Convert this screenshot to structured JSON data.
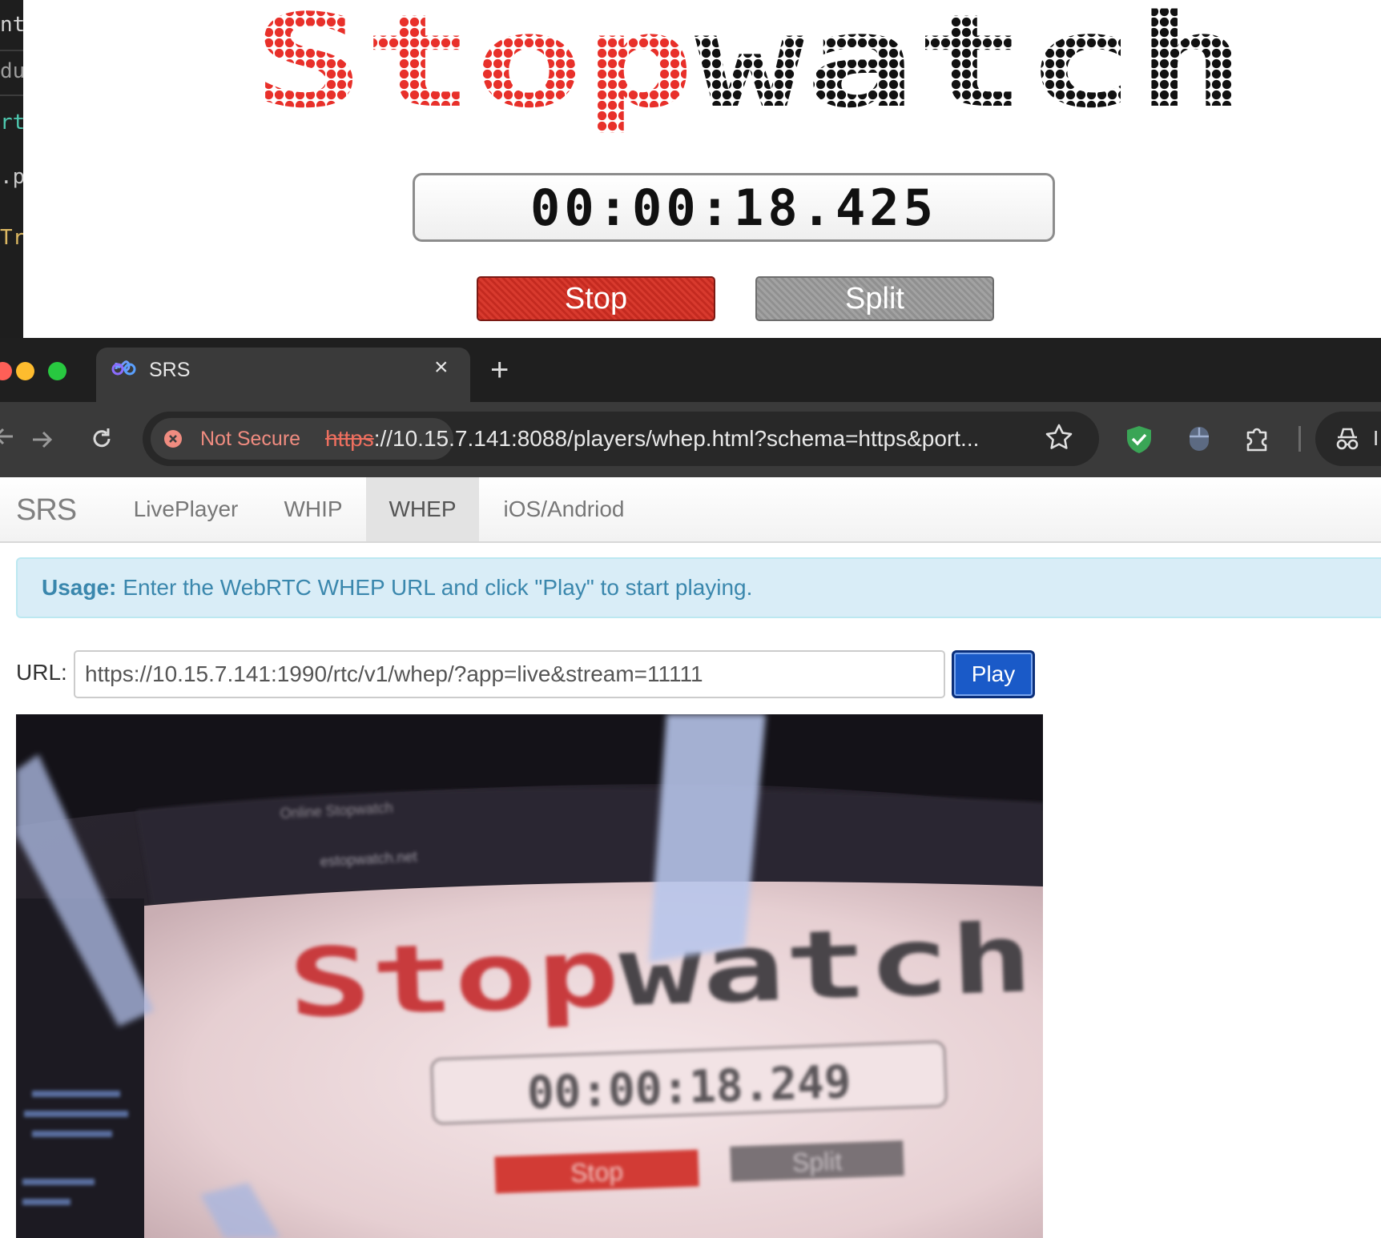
{
  "editor": {
    "fragments": [
      "nt(",
      "du",
      "rtc",
      ".py",
      "Tra"
    ]
  },
  "stopwatch": {
    "logo_text": "Stopwatch",
    "time": "00:00:18.425",
    "stop_label": "Stop",
    "split_label": "Split",
    "colors": {
      "logo_red": "#e8302a",
      "logo_black": "#111111",
      "stop_red": "#d0342a",
      "split_gray": "#9a9a9a"
    }
  },
  "browser": {
    "tab_title": "SRS",
    "tab_close": "×",
    "new_tab": "+",
    "security_label": "Not Secure",
    "url_scheme": "https",
    "url_rest": "://10.15.7.141:8088/players/whep.html?schema=https&port...",
    "icons": [
      "back-icon",
      "forward-icon",
      "reload-icon",
      "not-secure-icon",
      "bookmark-star-icon",
      "shield-extension-icon",
      "mouse-extension-icon",
      "extensions-puzzle-icon",
      "incognito-icon"
    ],
    "colors": {
      "tabbar": "#1f1f1f",
      "toolbar": "#3a3a3a",
      "warning": "#ee6f5f"
    }
  },
  "srs": {
    "brand": "SRS",
    "nav": [
      {
        "label": "LivePlayer",
        "active": false
      },
      {
        "label": "WHIP",
        "active": false
      },
      {
        "label": "WHEP",
        "active": true
      },
      {
        "label": "iOS/Andriod",
        "active": false
      }
    ],
    "alert_strong": "Usage:",
    "alert_text": "Enter the WebRTC WHEP URL and click \"Play\" to start playing.",
    "url_label": "URL:",
    "url_value": "https://10.15.7.141:1990/rtc/v1/whep/?app=live&stream=11111",
    "play_label": "Play"
  },
  "video": {
    "logo_text": "Stopwatch",
    "time": "00:00:18.249",
    "stop_label": "Stop",
    "split_label": "Split",
    "window_title": "Online Stopwatch",
    "address": "estopwatch.net"
  }
}
